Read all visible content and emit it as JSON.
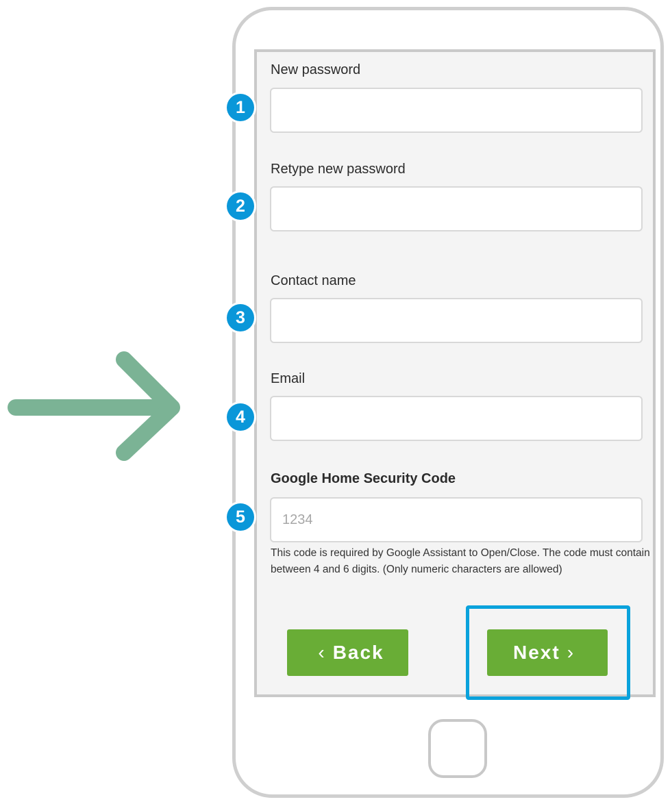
{
  "form": {
    "new_password": {
      "label": "New password",
      "value": "",
      "step": "1"
    },
    "retype_password": {
      "label": "Retype new password",
      "value": "",
      "step": "2"
    },
    "contact_name": {
      "label": "Contact name",
      "value": "",
      "step": "3"
    },
    "email": {
      "label": "Email",
      "value": "",
      "step": "4"
    },
    "security_code": {
      "label": "Google Home Security Code",
      "placeholder": "1234",
      "value": "",
      "step": "5",
      "help": "This code is required by Google Assistant to Open/Close. The code must contain between 4 and 6 digits. (Only numeric characters are allowed)"
    }
  },
  "buttons": {
    "back_label": "Back",
    "next_label": "Next"
  },
  "icons": {
    "back": "chevron-left-icon",
    "next": "chevron-right-icon",
    "pointer": "arrow-right-icon"
  },
  "colors": {
    "step_badge": "#0a97d9",
    "button": "#69ad36",
    "highlight": "#0aa2dc",
    "arrow": "#7bb395"
  }
}
